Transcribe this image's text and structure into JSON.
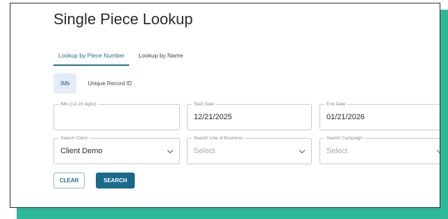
{
  "colors": {
    "accent": "#2eb89a",
    "primary": "#1a6a8c"
  },
  "page": {
    "title": "Single Piece Lookup"
  },
  "tabs": [
    {
      "label": "Lookup by Piece Number",
      "active": true
    },
    {
      "label": "Lookup by Name",
      "active": false
    }
  ],
  "subtabs": [
    {
      "label": "IMb",
      "active": true
    },
    {
      "label": "Unique Record ID",
      "active": false
    }
  ],
  "fields": {
    "imb": {
      "label": "IMb (1st 20 digits)",
      "value": ""
    },
    "start_date": {
      "label": "Start Date",
      "value": "12/21/2025"
    },
    "end_date": {
      "label": "End Date",
      "value": "01/21/2026"
    },
    "client": {
      "label": "Search Client",
      "value": "Client Demo"
    },
    "line_of_business": {
      "label": "Search Line of Business",
      "placeholder": "Select"
    },
    "campaign": {
      "label": "Search Campaign",
      "placeholder": "Select"
    }
  },
  "buttons": {
    "clear": "CLEAR",
    "search": "SEARCH"
  }
}
